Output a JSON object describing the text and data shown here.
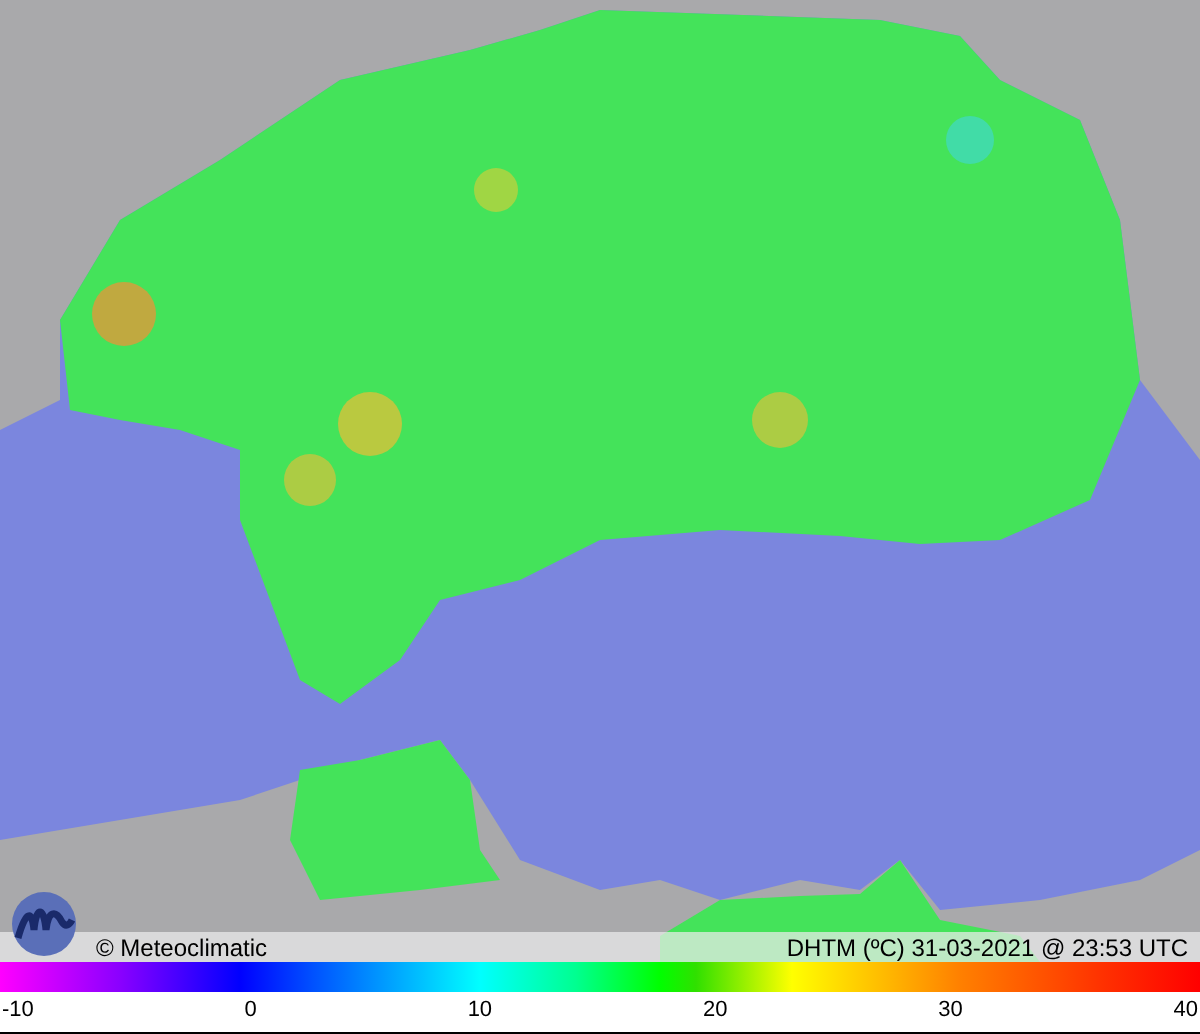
{
  "map": {
    "credit": "© Meteoclimatic",
    "caption": "DHTM (ºC) 31-03-2021 @ 23:53 UTC"
  },
  "color_scale": {
    "ticks": [
      "-10",
      "0",
      "10",
      "20",
      "30",
      "40"
    ]
  }
}
